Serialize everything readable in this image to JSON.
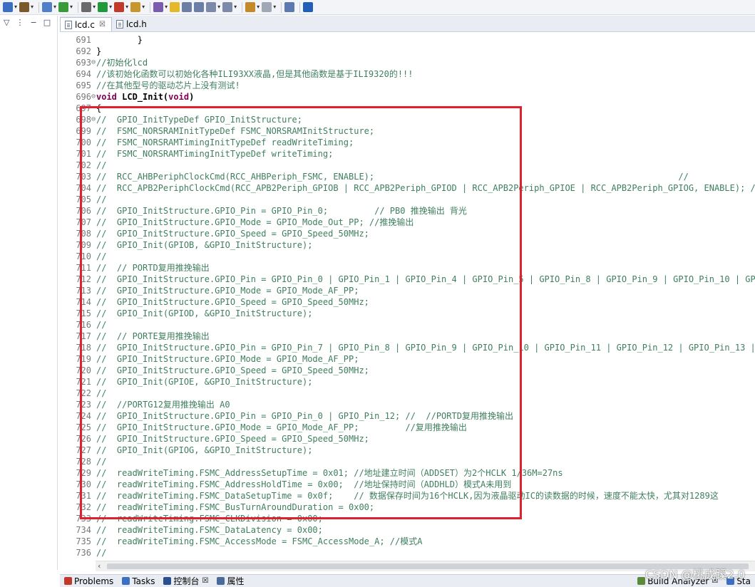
{
  "toolbar": {
    "items": [
      {
        "icon": "new-project-icon",
        "color": "#3b6fc4"
      },
      {
        "icon": "build-icon",
        "color": "#7a5a2a"
      },
      {
        "icon": "new-file-icon",
        "color": "#4f7fc9"
      },
      {
        "icon": "refresh-icon",
        "color": "#3a9a3a"
      },
      {
        "icon": "debug-icon",
        "color": "#6a6a6a"
      },
      {
        "icon": "run-icon",
        "color": "#1f9a3a"
      },
      {
        "icon": "external-tools-icon",
        "color": "#c0392b"
      },
      {
        "icon": "open-folder-icon",
        "color": "#c8962a"
      },
      {
        "icon": "pen-icon",
        "color": "#7b5bb0"
      },
      {
        "icon": "highlight-icon",
        "color": "#e3b82b"
      },
      {
        "icon": "block-icon",
        "color": "#6b7fa6"
      },
      {
        "icon": "paragraph-icon",
        "color": "#6b7fa6"
      },
      {
        "icon": "next-annotation-icon",
        "color": "#7a8aa8"
      },
      {
        "icon": "prev-annotation-icon",
        "color": "#7a8aa8"
      },
      {
        "icon": "back-icon",
        "color": "#c48a2a"
      },
      {
        "icon": "forward-icon",
        "color": "#a0a8b5"
      },
      {
        "icon": "pin-icon",
        "color": "#5a7ab0"
      },
      {
        "icon": "info-icon",
        "color": "#1f5fb8"
      }
    ]
  },
  "editor": {
    "tabs": [
      {
        "label": "lcd.c",
        "close": "☒",
        "active": true
      },
      {
        "label": "lcd.h",
        "active": false
      }
    ],
    "lines": [
      {
        "num": "691",
        "fold": "",
        "text": "        }",
        "type": "code"
      },
      {
        "num": "692",
        "fold": "",
        "text": "}",
        "type": "code"
      },
      {
        "num": "693",
        "fold": "⊖",
        "text": "//初始化lcd",
        "type": "comment"
      },
      {
        "num": "694",
        "fold": "",
        "text": "//该初始化函数可以初始化各种ILI93XX液晶,但是其他函数是基于ILI9320的!!!",
        "type": "comment"
      },
      {
        "num": "695",
        "fold": "",
        "text": "//在其他型号的驱动芯片上没有测试!",
        "type": "comment"
      },
      {
        "num": "696",
        "fold": "⊖",
        "text": "void LCD_Init(void)",
        "type": "decl"
      },
      {
        "num": "697",
        "fold": "",
        "text": "{",
        "type": "code"
      },
      {
        "num": "698",
        "fold": "⊖",
        "text": "//  GPIO_InitTypeDef GPIO_InitStructure;",
        "type": "comment"
      },
      {
        "num": "699",
        "fold": "",
        "text": "//  FSMC_NORSRAMInitTypeDef FSMC_NORSRAMInitStructure;",
        "type": "comment"
      },
      {
        "num": "700",
        "fold": "",
        "text": "//  FSMC_NORSRAMTimingInitTypeDef readWriteTiming;",
        "type": "comment"
      },
      {
        "num": "701",
        "fold": "",
        "text": "//  FSMC_NORSRAMTimingInitTypeDef writeTiming;",
        "type": "comment"
      },
      {
        "num": "702",
        "fold": "",
        "text": "//",
        "type": "comment"
      },
      {
        "num": "703",
        "fold": "",
        "text": "//  RCC_AHBPeriphClockCmd(RCC_AHBPeriph_FSMC, ENABLE);                                                           //",
        "type": "comment"
      },
      {
        "num": "704",
        "fold": "",
        "text": "//  RCC_APB2PeriphClockCmd(RCC_APB2Periph_GPIOB | RCC_APB2Periph_GPIOD | RCC_APB2Periph_GPIOE | RCC_APB2Periph_GPIOG, ENABLE); //",
        "type": "comment"
      },
      {
        "num": "705",
        "fold": "",
        "text": "//",
        "type": "comment"
      },
      {
        "num": "706",
        "fold": "",
        "text": "//  GPIO_InitStructure.GPIO_Pin = GPIO_Pin_0;         // PB0 推挽输出 背光",
        "type": "comment"
      },
      {
        "num": "707",
        "fold": "",
        "text": "//  GPIO_InitStructure.GPIO_Mode = GPIO_Mode_Out_PP; //推挽输出",
        "type": "comment"
      },
      {
        "num": "708",
        "fold": "",
        "text": "//  GPIO_InitStructure.GPIO_Speed = GPIO_Speed_50MHz;",
        "type": "comment"
      },
      {
        "num": "709",
        "fold": "",
        "text": "//  GPIO_Init(GPIOB, &GPIO_InitStructure);",
        "type": "comment"
      },
      {
        "num": "710",
        "fold": "",
        "text": "//",
        "type": "comment"
      },
      {
        "num": "711",
        "fold": "",
        "text": "//  // PORTD复用推挽输出",
        "type": "comment"
      },
      {
        "num": "712",
        "fold": "",
        "text": "//  GPIO_InitStructure.GPIO_Pin = GPIO_Pin_0 | GPIO_Pin_1 | GPIO_Pin_4 | GPIO_Pin_5 | GPIO_Pin_8 | GPIO_Pin_9 | GPIO_Pin_10 | GPI",
        "type": "comment"
      },
      {
        "num": "713",
        "fold": "",
        "text": "//  GPIO_InitStructure.GPIO_Mode = GPIO_Mode_AF_PP;",
        "type": "comment"
      },
      {
        "num": "714",
        "fold": "",
        "text": "//  GPIO_InitStructure.GPIO_Speed = GPIO_Speed_50MHz;",
        "type": "comment"
      },
      {
        "num": "715",
        "fold": "",
        "text": "//  GPIO_Init(GPIOD, &GPIO_InitStructure);",
        "type": "comment"
      },
      {
        "num": "716",
        "fold": "",
        "text": "//",
        "type": "comment"
      },
      {
        "num": "717",
        "fold": "",
        "text": "//  // PORTE复用推挽输出",
        "type": "comment"
      },
      {
        "num": "718",
        "fold": "",
        "text": "//  GPIO_InitStructure.GPIO_Pin = GPIO_Pin_7 | GPIO_Pin_8 | GPIO_Pin_9 | GPIO_Pin_10 | GPIO_Pin_11 | GPIO_Pin_12 | GPIO_Pin_13 |",
        "type": "comment"
      },
      {
        "num": "719",
        "fold": "",
        "text": "//  GPIO_InitStructure.GPIO_Mode = GPIO_Mode_AF_PP;",
        "type": "comment"
      },
      {
        "num": "720",
        "fold": "",
        "text": "//  GPIO_InitStructure.GPIO_Speed = GPIO_Speed_50MHz;",
        "type": "comment"
      },
      {
        "num": "721",
        "fold": "",
        "text": "//  GPIO_Init(GPIOE, &GPIO_InitStructure);",
        "type": "comment"
      },
      {
        "num": "722",
        "fold": "",
        "text": "//",
        "type": "comment"
      },
      {
        "num": "723",
        "fold": "",
        "text": "//  //PORTG12复用推挽输出 A0",
        "type": "comment"
      },
      {
        "num": "724",
        "fold": "",
        "text": "//  GPIO_InitStructure.GPIO_Pin = GPIO_Pin_0 | GPIO_Pin_12; //  //PORTD复用推挽输出",
        "type": "comment"
      },
      {
        "num": "725",
        "fold": "",
        "text": "//  GPIO_InitStructure.GPIO_Mode = GPIO_Mode_AF_PP;         //复用推挽输出",
        "type": "comment"
      },
      {
        "num": "726",
        "fold": "",
        "text": "//  GPIO_InitStructure.GPIO_Speed = GPIO_Speed_50MHz;",
        "type": "comment"
      },
      {
        "num": "727",
        "fold": "",
        "text": "//  GPIO_Init(GPIOG, &GPIO_InitStructure);",
        "type": "comment"
      },
      {
        "num": "728",
        "fold": "",
        "text": "//",
        "type": "comment"
      },
      {
        "num": "729",
        "fold": "",
        "text": "//  readWriteTiming.FSMC_AddressSetupTime = 0x01; //地址建立时间（ADDSET）为2个HCLK 1/36M=27ns",
        "type": "comment"
      },
      {
        "num": "730",
        "fold": "",
        "text": "//  readWriteTiming.FSMC_AddressHoldTime = 0x00;  //地址保持时间（ADDHLD）模式A未用到",
        "type": "comment"
      },
      {
        "num": "731",
        "fold": "",
        "text": "//  readWriteTiming.FSMC_DataSetupTime = 0x0f;    // 数据保存时间为16个HCLK,因为液晶驱动IC的读数据的时候，速度不能太快，尤其对1289这",
        "type": "comment"
      },
      {
        "num": "732",
        "fold": "",
        "text": "//  readWriteTiming.FSMC_BusTurnAroundDuration = 0x00;",
        "type": "comment"
      },
      {
        "num": "733",
        "fold": "",
        "text": "//  readWriteTiming.FSMC_CLKDivision = 0x00;",
        "type": "comment"
      },
      {
        "num": "734",
        "fold": "",
        "text": "//  readWriteTiming.FSMC_DataLatency = 0x00;",
        "type": "comment"
      },
      {
        "num": "735",
        "fold": "",
        "text": "//  readWriteTiming.FSMC_AccessMode = FSMC_AccessMode_A; //模式A",
        "type": "comment"
      },
      {
        "num": "736",
        "fold": "",
        "text": "//",
        "type": "comment"
      }
    ]
  },
  "bottom_panel": {
    "tabs": [
      {
        "label": "Problems",
        "icon": "problems-icon",
        "color": "#c0392b"
      },
      {
        "label": "Tasks",
        "icon": "tasks-icon",
        "color": "#3b6fc4"
      },
      {
        "label": "控制台",
        "icon": "console-icon",
        "color": "#2a4f8f",
        "close": "☒"
      },
      {
        "label": "属性",
        "icon": "properties-icon",
        "color": "#4a6a9a"
      },
      {
        "label": "Build Analyzer",
        "icon": "build-analyzer-icon",
        "color": "#5a8a3a",
        "close": "☒"
      },
      {
        "label": "Sta",
        "icon": "static-stack-icon",
        "color": "#3b6fc4"
      }
    ]
  },
  "watermark": "CSDN @桃成蹊2.0"
}
